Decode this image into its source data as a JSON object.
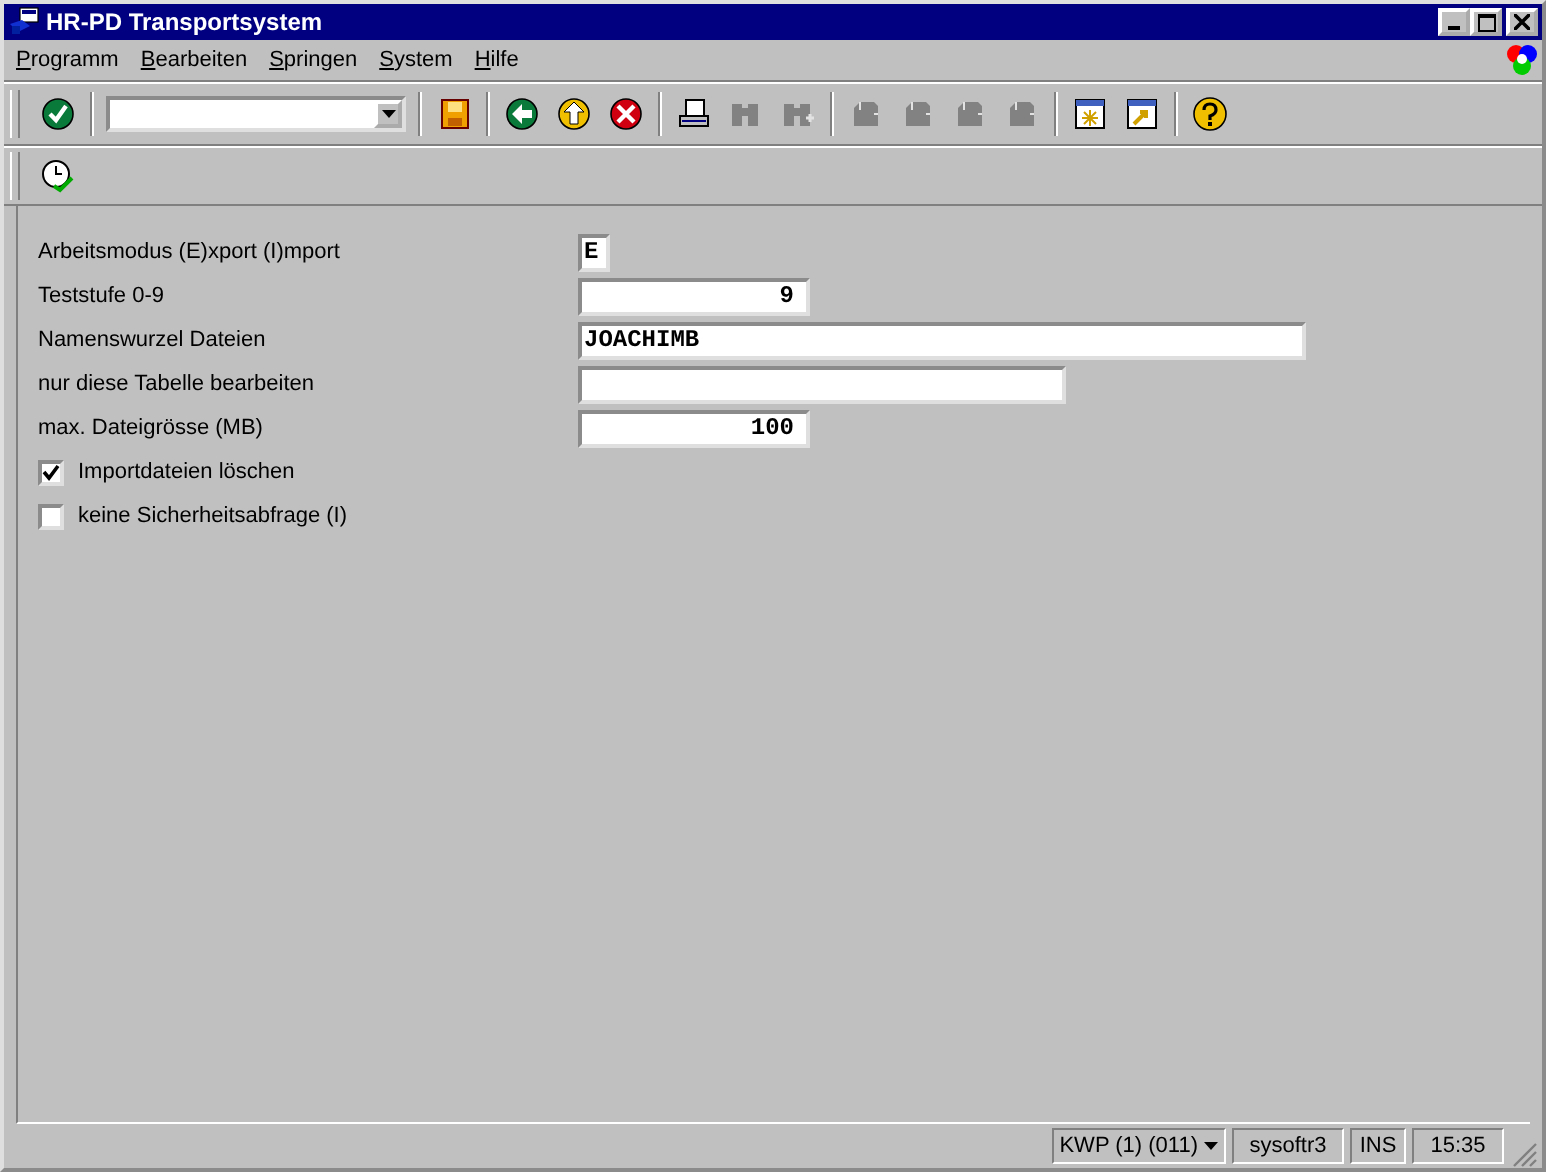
{
  "window": {
    "title": "HR-PD Transportsystem"
  },
  "menu": [
    "Programm",
    "Bearbeiten",
    "Springen",
    "System",
    "Hilfe"
  ],
  "toolbar": [
    {
      "kind": "check",
      "disabled": false
    },
    {
      "kind": "command",
      "disabled": false
    },
    {
      "kind": "save",
      "disabled": false
    },
    {
      "kind": "back",
      "disabled": false
    },
    {
      "kind": "exit",
      "disabled": false
    },
    {
      "kind": "cancel",
      "disabled": false
    },
    {
      "kind": "print",
      "disabled": false
    },
    {
      "kind": "find",
      "disabled": true
    },
    {
      "kind": "find-next",
      "disabled": true
    },
    {
      "kind": "first-page",
      "disabled": true
    },
    {
      "kind": "prev-page",
      "disabled": true
    },
    {
      "kind": "next-page",
      "disabled": true
    },
    {
      "kind": "last-page",
      "disabled": true
    },
    {
      "kind": "new-session",
      "disabled": false
    },
    {
      "kind": "shortcut",
      "disabled": false
    },
    {
      "kind": "help",
      "disabled": false
    }
  ],
  "app_toolbar": [
    {
      "kind": "execute"
    }
  ],
  "fields": [
    {
      "label": "Arbeitsmodus (E)xport (I)mport",
      "value": "E",
      "kind": "flag"
    },
    {
      "label": "Teststufe 0-9",
      "value": "9",
      "kind": "number"
    },
    {
      "label": "Namenswurzel Dateien",
      "value": "JOACHIMB",
      "kind": "long"
    },
    {
      "label": "nur diese Tabelle bearbeiten",
      "kind": "medium"
    },
    {
      "label": "max. Dateigrösse (MB)",
      "value": "100",
      "kind": "number"
    }
  ],
  "checkboxes": [
    {
      "label": "Importdateien löschen",
      "checked": true
    },
    {
      "label": "keine Sicherheitsabfrage (I)",
      "checked": false
    }
  ],
  "status_bar": {
    "system": "KWP (1) (011)",
    "server": "sysoftr3",
    "mode": "INS",
    "time": "15:35"
  }
}
